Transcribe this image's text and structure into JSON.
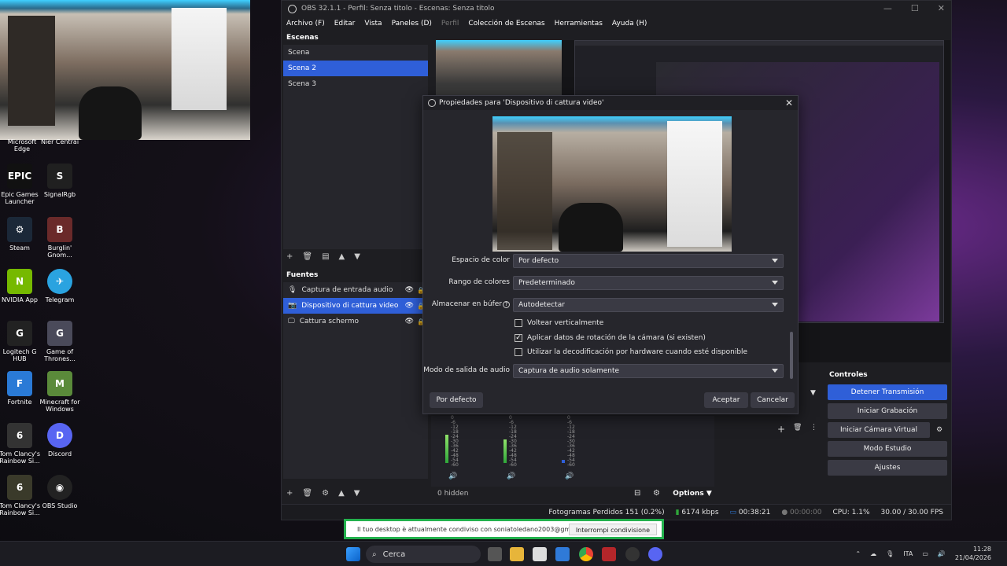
{
  "desktop": {
    "icons": [
      {
        "label": "Microsoft Edge",
        "color": "#1f8ad6",
        "glyph": "e"
      },
      {
        "label": "Epic Games Launcher",
        "color": "#111111",
        "glyph": "EPIC"
      },
      {
        "label": "Steam",
        "color": "#1b2838",
        "glyph": "S"
      },
      {
        "label": "NVIDIA App",
        "color": "#76b900",
        "glyph": "N"
      },
      {
        "label": "Logitech G HUB",
        "color": "#222222",
        "glyph": "G"
      },
      {
        "label": "Fortnite",
        "color": "#2a7ad6",
        "glyph": "F"
      },
      {
        "label": "Tom Clancy's Rainbow Si...",
        "color": "#333333",
        "glyph": "6"
      },
      {
        "label": "Tom Clancy's Rainbow Si...",
        "color": "#3a3a2a",
        "glyph": "6"
      },
      {
        "label": "Nier Centrai",
        "color": "#444444",
        "glyph": "N"
      },
      {
        "label": "SignalRgb",
        "color": "#202020",
        "glyph": "S"
      },
      {
        "label": "Burglin' Gnom...",
        "color": "#6a2a2a",
        "glyph": "B"
      },
      {
        "label": "Telegram",
        "color": "#2aa3e0",
        "glyph": "✈"
      },
      {
        "label": "Game of Thrones...",
        "color": "#4a4a5a",
        "glyph": "G"
      },
      {
        "label": "Minecraft for Windows",
        "color": "#5a8a3a",
        "glyph": "M"
      },
      {
        "label": "Discord",
        "color": "#5865f2",
        "glyph": "D"
      },
      {
        "label": "OBS Studio",
        "color": "#222222",
        "glyph": "◉"
      }
    ]
  },
  "obs": {
    "title": "OBS 32.1.1 - Perfil: Senza titolo - Escenas: Senza titolo",
    "menu": [
      "Archivo (F)",
      "Editar",
      "Vista",
      "Paneles (D)",
      "Perfil",
      "Colección de Escenas",
      "Herramientas",
      "Ayuda (H)"
    ],
    "scenes_title": "Escenas",
    "scenes": [
      "Scena",
      "Scena 2",
      "Scena 3"
    ],
    "sources_title": "Fuentes",
    "sources": [
      "Captura de entrada audio",
      "Dispositivo di cattura video",
      "Cattura schermo"
    ],
    "sources_hidden": "0 hidden",
    "options_label": "Options",
    "controls_title": "Controles",
    "controls": [
      "Detener Transmisión",
      "Iniciar Grabación",
      "Iniciar Cámara Virtual",
      "Modo Estudio",
      "Ajustes"
    ],
    "mixer_scale": [
      "0",
      "-6",
      "-12",
      "-18",
      "-24",
      "-30",
      "-36",
      "-42",
      "-48",
      "-54",
      "-60"
    ],
    "status": {
      "dropped": "Fotogramas Perdidos 151 (0.2%)",
      "bitrate": "6174 kbps",
      "stream_time": "00:38:21",
      "rec_time": "00:00:00",
      "cpu": "CPU: 1.1%",
      "fps": "30.00 / 30.00 FPS"
    }
  },
  "dialog": {
    "title": "Propiedades para 'Dispositivo di cattura video'",
    "fields": [
      {
        "label": "Espacio de color",
        "value": "Por defecto"
      },
      {
        "label": "Rango de colores",
        "value": "Predeterminado"
      },
      {
        "label": "Almacenar en búfer",
        "value": "Autodetectar"
      },
      {
        "label": "Modo de salida de audio",
        "value": "Captura de audio solamente"
      }
    ],
    "checks": [
      {
        "label": "Voltear verticalmente",
        "checked": false
      },
      {
        "label": "Aplicar datos de rotación de la cámara (si existen)",
        "checked": true
      },
      {
        "label": "Utilizar la decodificación por hardware cuando esté disponible",
        "checked": false
      }
    ],
    "defaults_button": "Por defecto",
    "ok_button": "Aceptar",
    "cancel_button": "Cancelar"
  },
  "sharebar": {
    "message": "Il tuo desktop è attualmente condiviso con soniatoledano2003@gmail.com",
    "stop_button": "Interrompi condivisione"
  },
  "taskbar": {
    "search_placeholder": "Cerca",
    "lang": "ITA",
    "time": "11:28",
    "date": "21/04/2026"
  }
}
